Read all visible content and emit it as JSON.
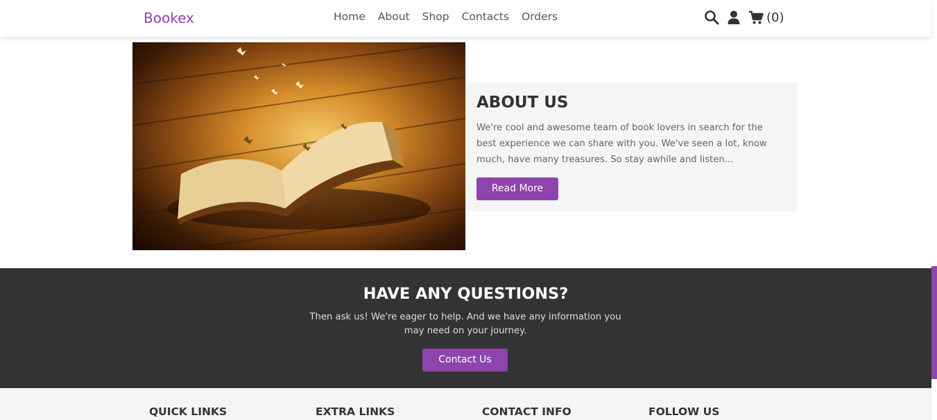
{
  "header": {
    "logo": "Bookex",
    "nav": [
      "Home",
      "About",
      "Shop",
      "Contacts",
      "Orders"
    ],
    "icons": [
      "search-icon",
      "user-icon",
      "cart-icon"
    ],
    "cart_count": "(0)"
  },
  "about": {
    "title": "ABOUT US",
    "text": "We're cool and awesome team of book lovers in search for the best experience we can share with you. We've seen a lot, know much, have many treasures. So stay awhile and listen...",
    "button": "Read More"
  },
  "questions": {
    "title": "HAVE ANY QUESTIONS?",
    "text": "Then ask us! We're eager to help. And we have any information you may need on your journey.",
    "button": "Contact Us"
  },
  "footer": {
    "columns": [
      "QUICK LINKS",
      "EXTRA LINKS",
      "CONTACT INFO",
      "FOLLOW US"
    ]
  },
  "colors": {
    "accent": "#8e44ad",
    "dark": "#333333",
    "light_bg": "#f5f5f5"
  }
}
